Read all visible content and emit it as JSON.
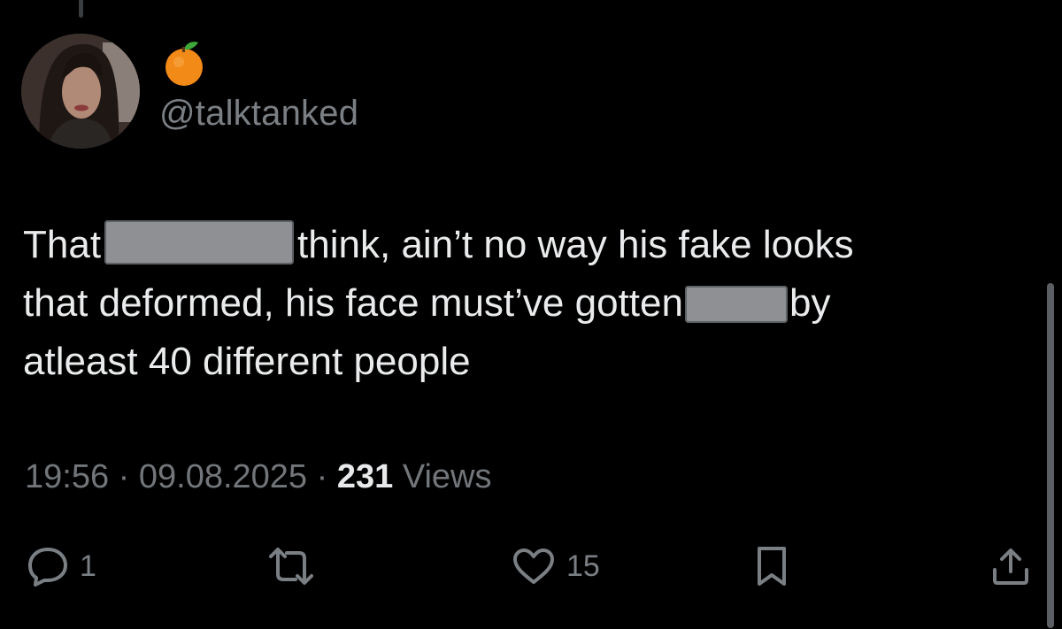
{
  "tweet": {
    "handle": "@talktanked",
    "badge_icon": "tangerine-emoji",
    "text": {
      "line1_start": "That",
      "line1_end": "think, ain’t no way his fake looks",
      "line2_start": "that deformed, his face must’ve gotten",
      "line2_end": "by",
      "line3": "atleast 40 different people"
    },
    "time": "19:56",
    "date": "09.08.2025",
    "separator": "·",
    "views_count": "231",
    "views_label": "Views"
  },
  "actions": {
    "reply_count": "1",
    "like_count": "15",
    "icons": [
      "reply-icon",
      "retweet-icon",
      "like-icon",
      "bookmark-icon",
      "share-icon"
    ]
  },
  "colors": {
    "background": "#000000",
    "text": "#e7e9ea",
    "muted": "#72767a",
    "redaction": "#8e9093"
  }
}
